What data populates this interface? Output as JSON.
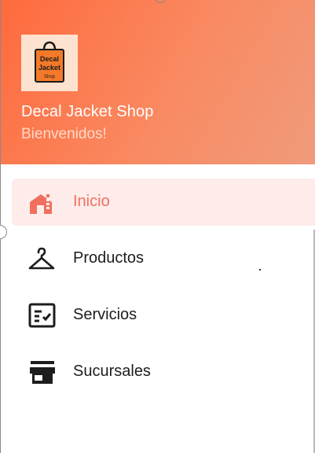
{
  "header": {
    "logo": {
      "text_lines": [
        "Decal",
        "Jacket",
        "Shop"
      ]
    },
    "shop_name": "Decal Jacket Shop",
    "welcome": "Bienvenidos!"
  },
  "colors": {
    "accent": "#f0705e",
    "active_background": "#fdecea",
    "header_gradient_start": "#ff6a3d",
    "header_gradient_end": "#ef9b7c"
  },
  "menu": {
    "items": [
      {
        "label": "Inicio",
        "icon": "home-icon",
        "active": true
      },
      {
        "label": "Productos",
        "icon": "hanger-icon",
        "active": false
      },
      {
        "label": "Servicios",
        "icon": "checklist-icon",
        "active": false
      },
      {
        "label": "Sucursales",
        "icon": "store-icon",
        "active": false
      }
    ]
  }
}
